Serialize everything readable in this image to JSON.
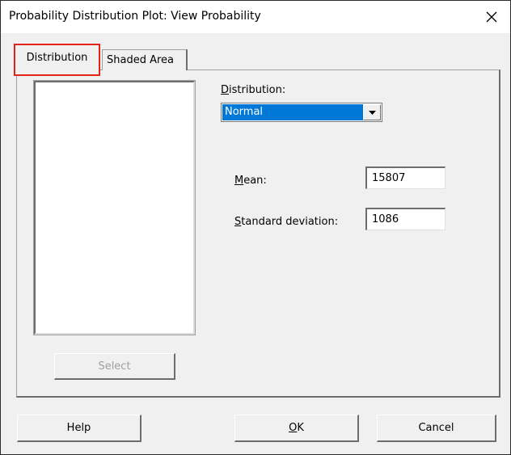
{
  "window": {
    "title": "Probability Distribution Plot: View Probability",
    "close_icon": "close-icon"
  },
  "tabs": [
    {
      "label": "Distribution",
      "active": true,
      "highlight_color": "#e2231a"
    },
    {
      "label": "Shaded Area",
      "active": false
    }
  ],
  "left_panel": {
    "list_items": [],
    "select_label": "Select"
  },
  "distribution": {
    "label": "Distribution:",
    "selected": "Normal",
    "selected_bg": "#0078d7"
  },
  "params": {
    "mean_label": "Mean:",
    "mean_value": "15807",
    "sd_label": "Standard deviation:",
    "sd_value": "1086"
  },
  "buttons": {
    "help": "Help",
    "ok": "OK",
    "cancel": "Cancel"
  }
}
